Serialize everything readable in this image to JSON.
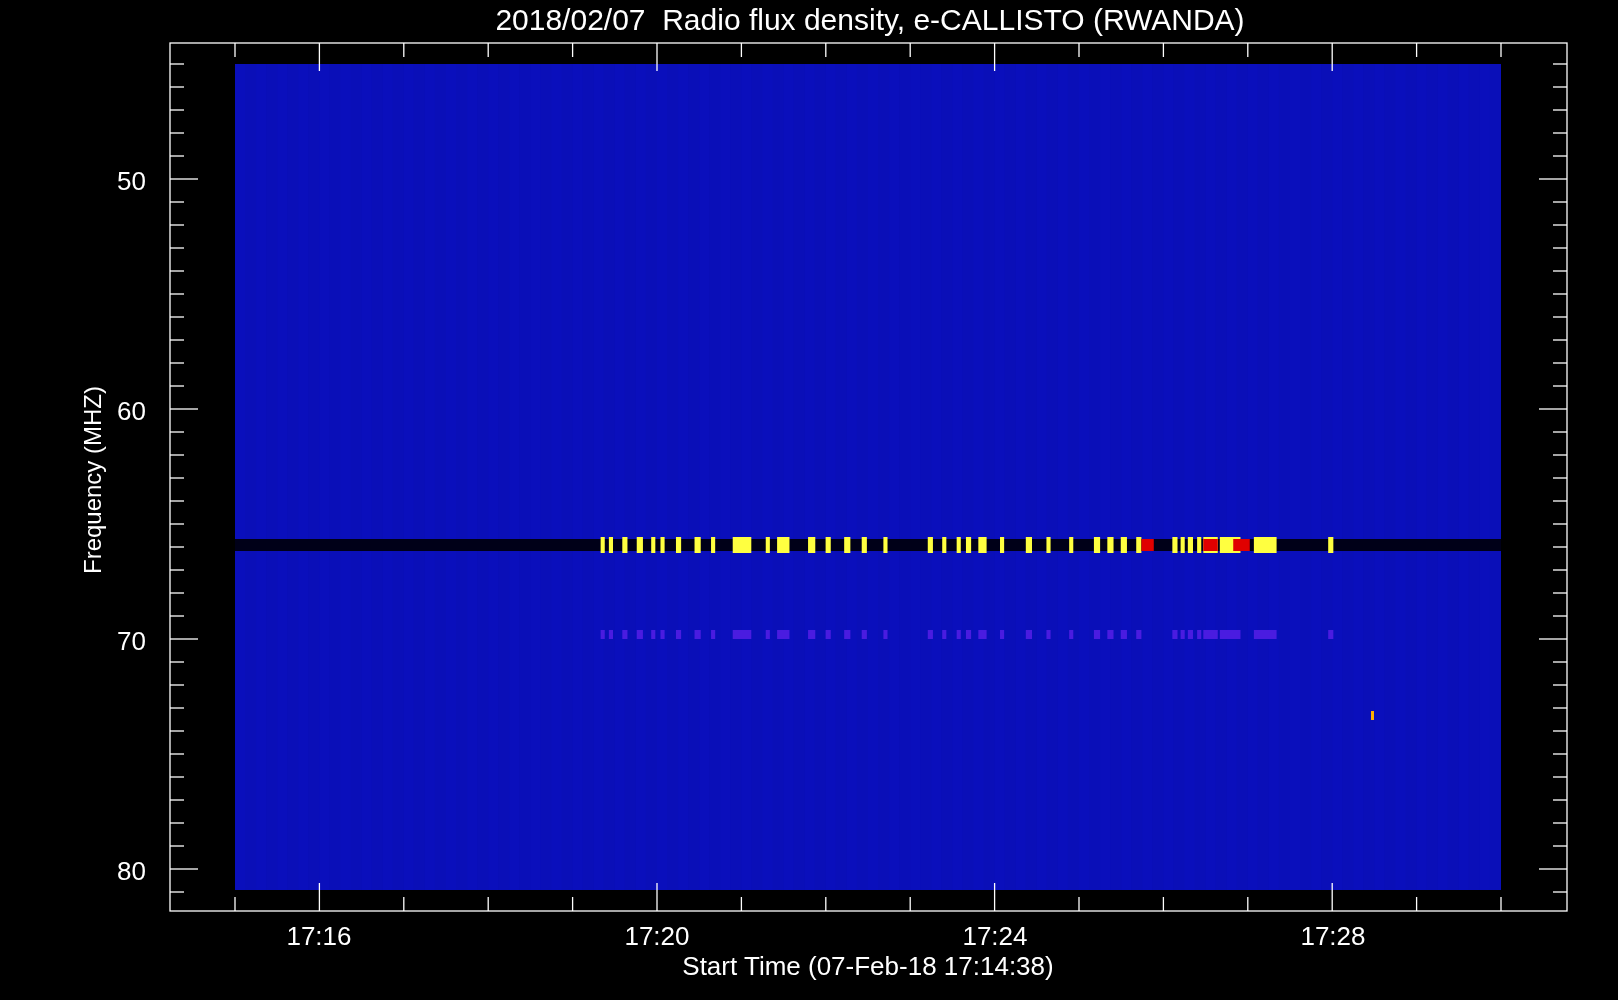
{
  "title": "2018/02/07  Radio flux density, e-CALLISTO (RWANDA)",
  "y_axis": {
    "label": "Frequency (MHZ)",
    "ticks": [
      "50",
      "60",
      "70",
      "80"
    ]
  },
  "x_axis": {
    "label": "Start Time (07-Feb-18 17:14:38)",
    "ticks": [
      "17:16",
      "17:20",
      "17:24",
      "17:28"
    ]
  }
}
